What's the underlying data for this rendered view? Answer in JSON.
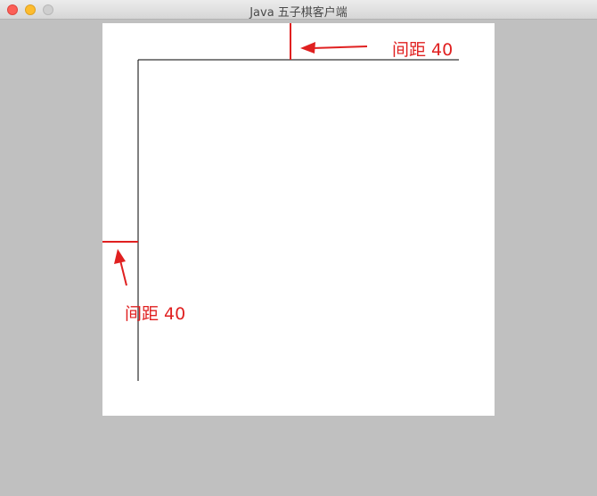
{
  "window": {
    "title": "Java 五子棋客户端"
  },
  "annotations": {
    "top_label": "间距 40",
    "left_label": "间距 40"
  },
  "colors": {
    "desktop": "#c0c0c0",
    "canvas": "#ffffff",
    "grid_line": "#000000",
    "annotation": "#e02020"
  },
  "icons": {
    "close": "close-icon",
    "minimize": "minimize-icon",
    "zoom": "zoom-icon",
    "arrow_top": "arrow-left-icon",
    "arrow_left": "arrow-up-icon"
  }
}
